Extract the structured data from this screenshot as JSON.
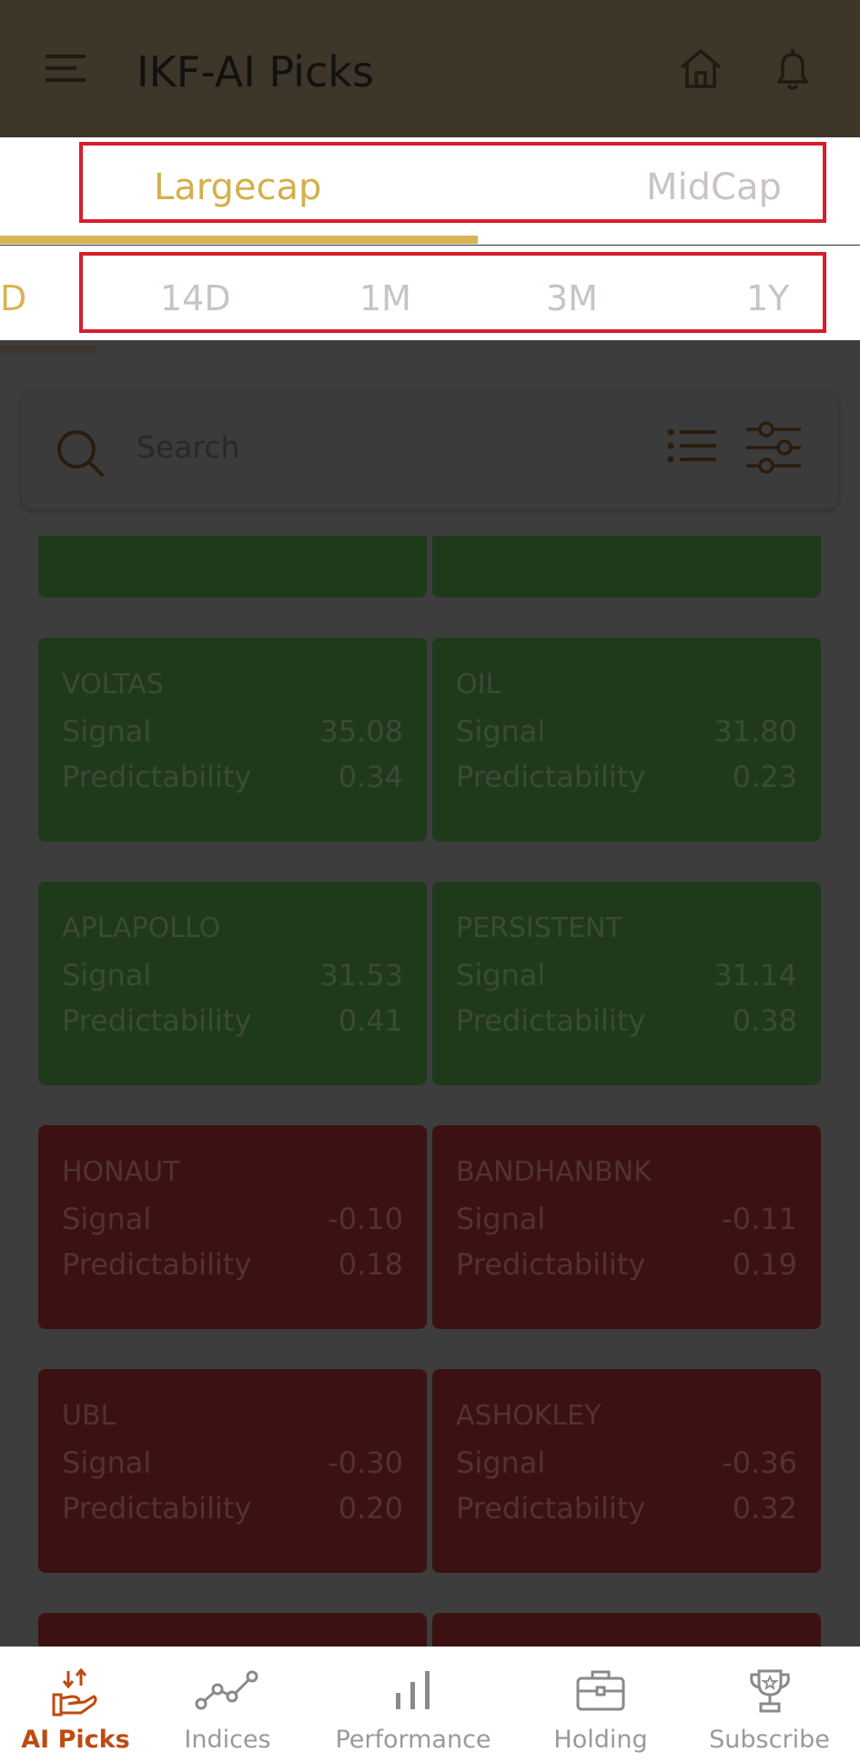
{
  "appbar": {
    "title": "IKF-AI Picks",
    "menu_icon": "hamburger-menu-icon",
    "home_icon": "home-icon",
    "bell_icon": "bell-icon"
  },
  "cap_tabs": {
    "items": [
      {
        "label": "Largecap",
        "active": true
      },
      {
        "label": "MidCap",
        "active": false
      }
    ]
  },
  "period_tabs": {
    "items": [
      {
        "label": "D",
        "active": true
      },
      {
        "label": "14D",
        "active": false
      },
      {
        "label": "1M",
        "active": false
      },
      {
        "label": "3M",
        "active": false
      },
      {
        "label": "1Y",
        "active": false
      }
    ]
  },
  "search": {
    "placeholder": "Search",
    "list_icon": "list-view-icon",
    "filter_icon": "filter-sliders-icon"
  },
  "cards": [
    {
      "name": "VOLTAS",
      "signal_label": "Signal",
      "signal": "35.08",
      "pred_label": "Predictability",
      "predictability": "0.34",
      "color": "green"
    },
    {
      "name": "OIL",
      "signal_label": "Signal",
      "signal": "31.80",
      "pred_label": "Predictability",
      "predictability": "0.23",
      "color": "green"
    },
    {
      "name": "APLAPOLLO",
      "signal_label": "Signal",
      "signal": "31.53",
      "pred_label": "Predictability",
      "predictability": "0.41",
      "color": "green"
    },
    {
      "name": "PERSISTENT",
      "signal_label": "Signal",
      "signal": "31.14",
      "pred_label": "Predictability",
      "predictability": "0.38",
      "color": "green"
    },
    {
      "name": "HONAUT",
      "signal_label": "Signal",
      "signal": "-0.10",
      "pred_label": "Predictability",
      "predictability": "0.18",
      "color": "red"
    },
    {
      "name": "BANDHANBNK",
      "signal_label": "Signal",
      "signal": "-0.11",
      "pred_label": "Predictability",
      "predictability": "0.19",
      "color": "red"
    },
    {
      "name": "UBL",
      "signal_label": "Signal",
      "signal": "-0.30",
      "pred_label": "Predictability",
      "predictability": "0.20",
      "color": "red"
    },
    {
      "name": "ASHOKLEY",
      "signal_label": "Signal",
      "signal": "-0.36",
      "pred_label": "Predictability",
      "predictability": "0.32",
      "color": "red"
    }
  ],
  "bottom_nav": {
    "items": [
      {
        "label": "AI Picks",
        "icon": "ai-picks-hand-icon",
        "active": true
      },
      {
        "label": "Indices",
        "icon": "line-chart-icon",
        "active": false
      },
      {
        "label": "Performance",
        "icon": "bar-chart-icon",
        "active": false
      },
      {
        "label": "Holding",
        "icon": "briefcase-icon",
        "active": false
      },
      {
        "label": "Subscribe",
        "icon": "trophy-icon",
        "active": false
      }
    ]
  },
  "colors": {
    "accent_gold": "#d8b553",
    "active_nav": "#bd4b12",
    "highlight_red": "#d61e2d",
    "card_green": "#1f3a1b",
    "card_red": "#3b1211"
  }
}
